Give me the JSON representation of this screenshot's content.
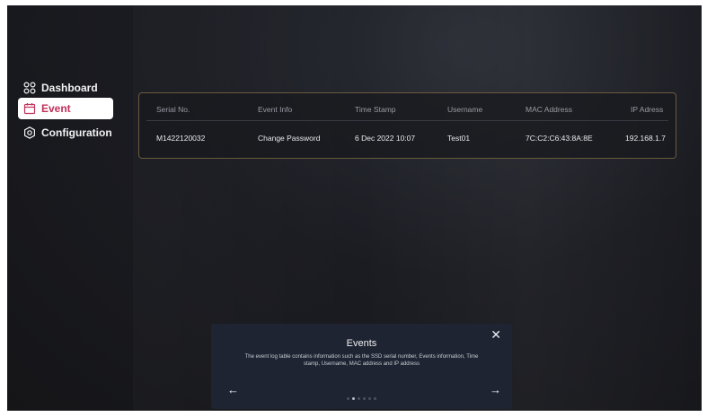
{
  "sidebar": {
    "items": [
      {
        "label": "Dashboard",
        "icon": "dashboard-grid-icon",
        "active": false
      },
      {
        "label": "Event",
        "icon": "calendar-icon",
        "active": true
      },
      {
        "label": "Configuration",
        "icon": "configuration-gear-icon",
        "active": false
      }
    ]
  },
  "table": {
    "headers": [
      "Serial No.",
      "Event Info",
      "Time Stamp",
      "Username",
      "MAC Address",
      "IP Adress"
    ],
    "rows": [
      [
        "M1422120032",
        "Change Password",
        "6 Dec 2022 10:07",
        "Test01",
        "7C:C2:C6:43:8A:8E",
        "192.168.1.7"
      ]
    ]
  },
  "tour": {
    "title": "Events",
    "description": "The event log table contains information such as the SSD serial number, Events information, Time stamp, Username, MAC address and IP address",
    "close_icon": "close-icon",
    "prev_icon": "arrow-left-icon",
    "next_icon": "arrow-right-icon",
    "dots": {
      "total": 6,
      "active": 1
    }
  },
  "colors": {
    "active_accent": "#c0305a",
    "table_border": "#6a5a3c",
    "tour_bg": "#1e2431"
  }
}
